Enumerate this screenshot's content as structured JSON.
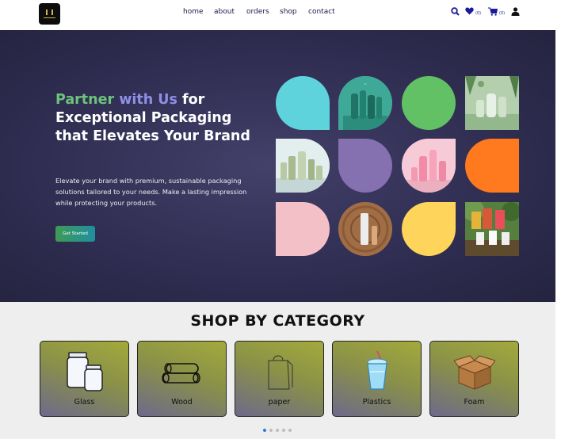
{
  "nav": {
    "links": [
      "home",
      "about",
      "orders",
      "shop",
      "contact"
    ],
    "wishlist_count": "(0)",
    "cart_count": "(0)"
  },
  "hero": {
    "title_highlight_1": "Partner",
    "title_highlight_2": "with Us",
    "title_rest": "for Exceptional Packaging that Elevates Your Brand",
    "description": "Elevate your brand with premium, sustainable packaging solutions tailored to your needs. Make a lasting impression while protecting your products.",
    "cta_label": "Get Started",
    "tiles": [
      {
        "kind": "color",
        "color": "#5fd3dc"
      },
      {
        "kind": "image",
        "subject": "teal-bottles-photo"
      },
      {
        "kind": "color",
        "color": "#62c065"
      },
      {
        "kind": "image",
        "subject": "green-bottles-photo"
      },
      {
        "kind": "image",
        "subject": "sage-bottles-photo"
      },
      {
        "kind": "color",
        "color": "#8570b0"
      },
      {
        "kind": "image",
        "subject": "pink-bottles-photo"
      },
      {
        "kind": "color",
        "color": "#ff7a1f"
      },
      {
        "kind": "color",
        "color": "#f4c0c8"
      },
      {
        "kind": "image",
        "subject": "tube-wood-photo"
      },
      {
        "kind": "color",
        "color": "#fed55a"
      },
      {
        "kind": "image",
        "subject": "bags-forest-photo"
      }
    ]
  },
  "category": {
    "title": "SHOP BY CATEGORY",
    "items": [
      {
        "label": "Glass",
        "icon": "glass-jars-icon"
      },
      {
        "label": "Wood",
        "icon": "wood-logs-icon"
      },
      {
        "label": "paper",
        "icon": "paper-bag-icon"
      },
      {
        "label": "Plastics",
        "icon": "plastic-cup-icon"
      },
      {
        "label": "Foam",
        "icon": "foam-box-icon"
      }
    ],
    "carousel_pages": 5,
    "carousel_active": 1
  },
  "colors": {
    "hero_bg": "#302e52",
    "accent_green": "#6cc37a",
    "accent_purple": "#8f8fe8",
    "nav_text": "#1a1a4e",
    "icon_blue": "#1a1aa0"
  }
}
